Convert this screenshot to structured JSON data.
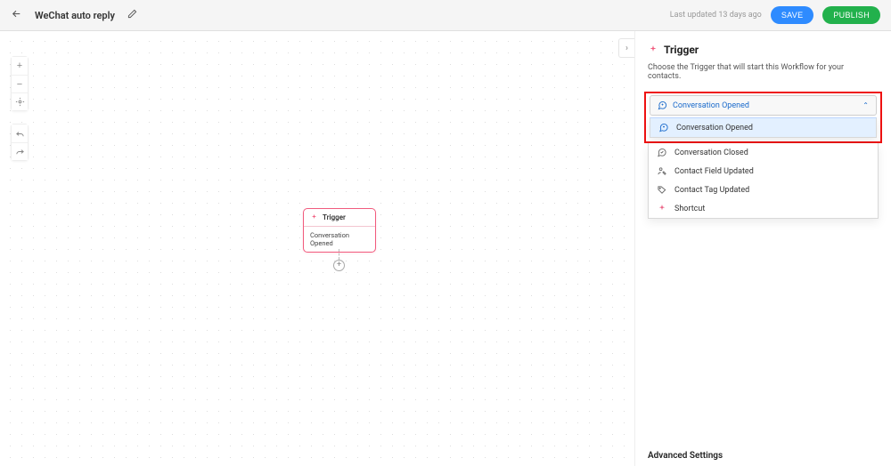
{
  "header": {
    "title": "WeChat auto reply",
    "last_updated": "Last updated 13 days ago",
    "save_label": "SAVE",
    "publish_label": "PUBLISH"
  },
  "canvas": {
    "tools": {
      "zoom_in": "+",
      "zoom_out": "−",
      "fit": "◈",
      "undo": "↶",
      "redo": "↷"
    },
    "collapse": "›",
    "add": "+",
    "node": {
      "title": "Trigger",
      "subtitle": "Conversation Opened"
    }
  },
  "panel": {
    "title": "Trigger",
    "description": "Choose the Trigger that will start this Workflow for your contacts.",
    "selected": "Conversation Opened",
    "options": {
      "conversation_opened": "Conversation Opened",
      "conversation_closed": "Conversation Closed",
      "contact_field_updated": "Contact Field Updated",
      "contact_tag_updated": "Contact Tag Updated",
      "shortcut": "Shortcut"
    },
    "advanced": "Advanced Settings"
  },
  "colors": {
    "accent_pink": "#f15b7e",
    "accent_blue": "#2e8bff",
    "accent_green": "#22b14c",
    "highlight_red": "#e11"
  }
}
